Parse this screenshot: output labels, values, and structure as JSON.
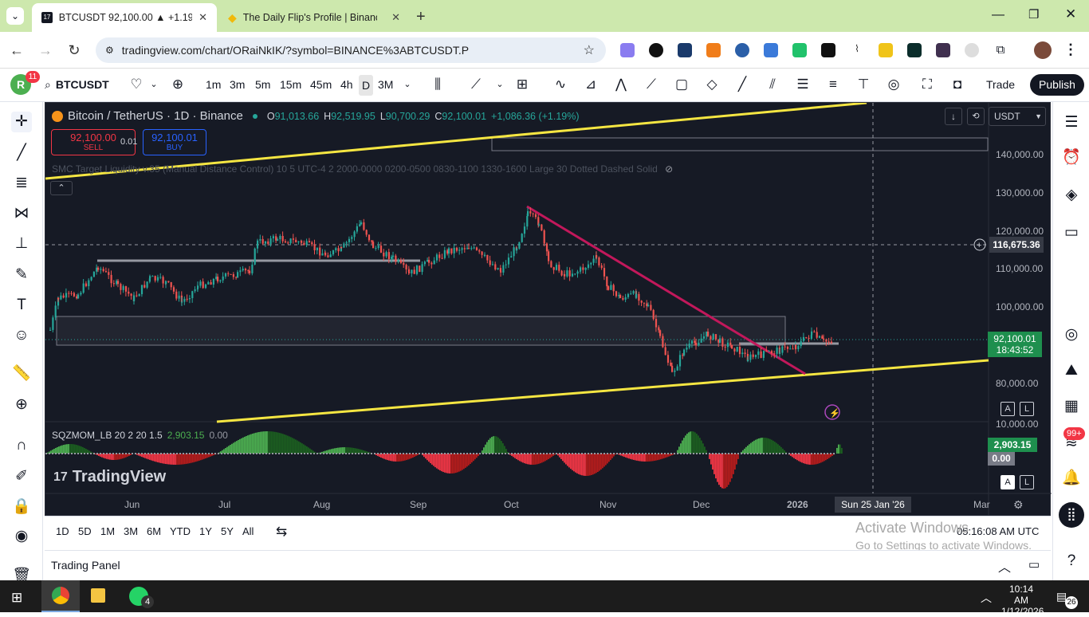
{
  "browser": {
    "tabs": [
      {
        "title": "BTCUSDT 92,100.00 ▲ +1.19% |"
      },
      {
        "title": "The Daily Flip's Profile | Binance"
      }
    ],
    "url": "tradingview.com/chart/ORaiNkIK/?symbol=BINANCE%3ABTCUSDT.P"
  },
  "toolbar": {
    "avatar": "R",
    "badge": "11",
    "symbol": "BTCUSDT",
    "intervals": [
      "1m",
      "3m",
      "5m",
      "15m",
      "45m",
      "4h",
      "D",
      "3M"
    ],
    "trade": "Trade",
    "publish": "Publish"
  },
  "legend": {
    "title": "Bitcoin / TetherUS · 1D · Binance",
    "o_label": "O",
    "o": "91,013.66",
    "h_label": "H",
    "h": "92,519.95",
    "l_label": "L",
    "l": "90,700.29",
    "c_label": "C",
    "c": "92,100.01",
    "change": "+1,086.36 (+1.19%)",
    "sell_price": "92,100.00",
    "sell": "SELL",
    "spread": "0.01",
    "buy_price": "92,100.01",
    "buy": "BUY",
    "indicator": "SMC Target Liquidity v.35 (Manual Distance Control) 10 5 UTC-4 2 2000-0000 0200-0500 0830-1100 1330-1600 Large 30 Dotted Dashed Solid",
    "osc": "SQZMOM_LB 20 2 20 1.5",
    "osc_v1": "2,903.15",
    "osc_v2": "0.00"
  },
  "currency": "USDT",
  "price_axis": [
    "140,000.00",
    "130,000.00",
    "120,000.00",
    "110,000.00",
    "100,000.00",
    "80,000.00",
    "10,000.00"
  ],
  "crosshair_price": "116,675.36",
  "last_price": "92,100.01",
  "countdown": "18:43:52",
  "osc_labels": [
    "2,903.15",
    "0.00"
  ],
  "time_axis": [
    "Jun",
    "Jul",
    "Aug",
    "Sep",
    "Oct",
    "Nov",
    "Dec",
    "2026",
    "Mar"
  ],
  "crosshair_time": "Sun 25 Jan '26",
  "logo": "TradingView",
  "ranges": [
    "1D",
    "5D",
    "1M",
    "3M",
    "6M",
    "YTD",
    "1Y",
    "5Y",
    "All"
  ],
  "clock": "05:16:08 AM UTC",
  "activate": {
    "title": "Activate Windows",
    "sub": "Go to Settings to activate Windows."
  },
  "trading_panel": "Trading Panel",
  "taskbar": {
    "time": "10:14 AM",
    "date": "1/12/2026",
    "notif": "26",
    "wa_badge": "4"
  },
  "right_badge": "99+",
  "colors": {
    "bg": "#161a25",
    "up": "#26a69a",
    "down": "#ef5350",
    "yellow": "#f5e642",
    "magenta": "#c2185b",
    "green_label": "#1e8f4e"
  }
}
